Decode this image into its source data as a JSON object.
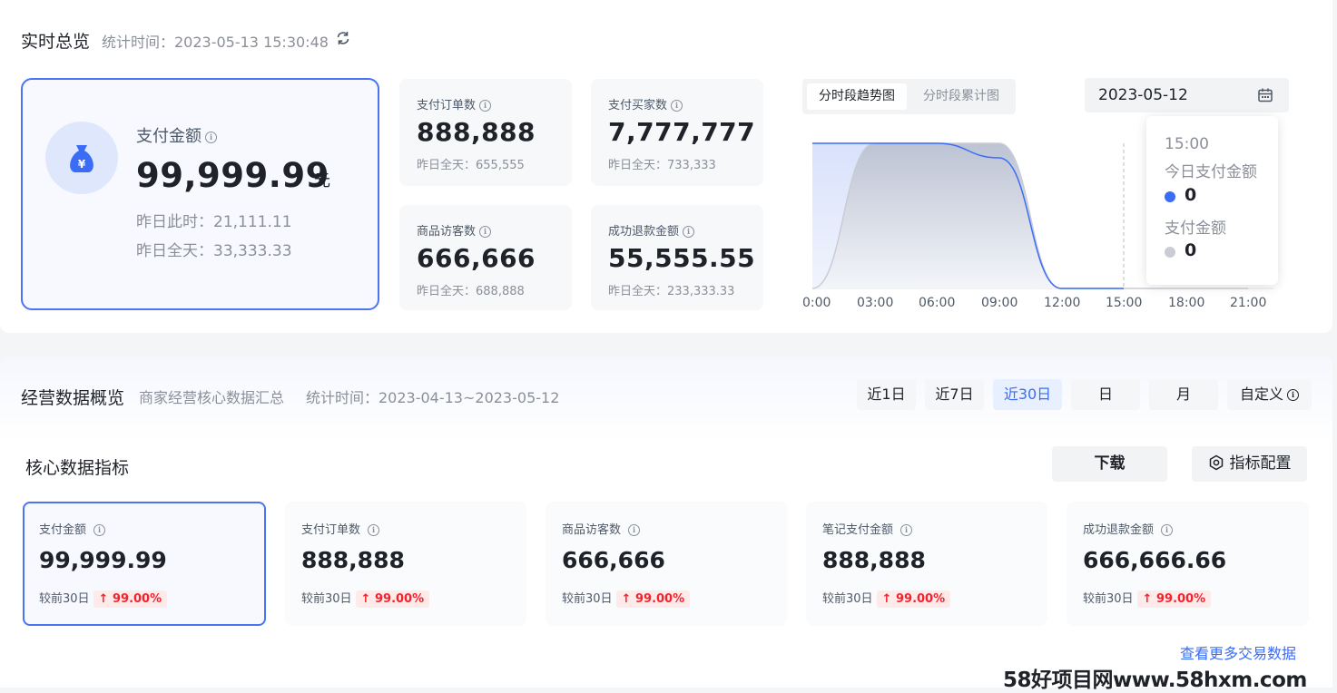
{
  "realtime": {
    "title": "实时总览",
    "time_label": "统计时间：2023-05-13 15:30:48",
    "main": {
      "label": "支付金额",
      "value": "99,999.99",
      "unit": "元",
      "yesterday_now": "昨日此时：21,111.11",
      "yesterday_full": "昨日全天：33,333.33"
    },
    "cards": [
      {
        "label": "支付订单数",
        "value": "888,888",
        "sub": "昨日全天：655,555"
      },
      {
        "label": "支付买家数",
        "value": "7,777,777",
        "sub": "昨日全天：733,333"
      },
      {
        "label": "商品访客数",
        "value": "666,666",
        "sub": "昨日全天：688,888"
      },
      {
        "label": "成功退款金额",
        "value": "55,555.55",
        "sub": "昨日全天：233,333.33"
      }
    ],
    "chart_tabs": [
      "分时段趋势图",
      "分时段累计图"
    ],
    "date": "2023-05-12",
    "tooltip": {
      "time": "15:00",
      "series1_label": "今日支付金额",
      "series1_value": "0",
      "series2_label": "支付金额",
      "series2_value": "0"
    }
  },
  "chart_data": {
    "type": "area",
    "x": [
      "0:00",
      "03:00",
      "06:00",
      "09:00",
      "12:00",
      "15:00",
      "18:00",
      "21:00"
    ],
    "series": [
      {
        "name": "今日支付金额",
        "color": "#3b6cf6",
        "values": [
          1,
          1,
          1,
          0.9,
          0,
          0,
          null,
          null
        ]
      },
      {
        "name": "支付金额",
        "color": "#c9ccd4",
        "values": [
          0,
          1,
          1,
          1,
          0,
          0,
          0,
          0
        ]
      }
    ],
    "hover_x": "15:00"
  },
  "business": {
    "title": "经营数据概览",
    "subtitle": "商家经营核心数据汇总",
    "time_label": "统计时间：2023-04-13~2023-05-12",
    "ranges": [
      "近1日",
      "近7日",
      "近30日",
      "日",
      "月",
      "自定义"
    ],
    "active_range": "近30日",
    "core_title": "核心数据指标",
    "download": "下载",
    "config": "指标配置",
    "metrics": [
      {
        "label": "支付金额",
        "value": "99,999.99",
        "comp": "较前30日",
        "change": "99.00%"
      },
      {
        "label": "支付订单数",
        "value": "888,888",
        "comp": "较前30日",
        "change": "99.00%"
      },
      {
        "label": "商品访客数",
        "value": "666,666",
        "comp": "较前30日",
        "change": "99.00%"
      },
      {
        "label": "笔记支付金额",
        "value": "888,888",
        "comp": "较前30日",
        "change": "99.00%"
      },
      {
        "label": "成功退款金额",
        "value": "666,666.66",
        "comp": "较前30日",
        "change": "99.00%"
      }
    ],
    "more_link": "查看更多交易数据"
  },
  "watermark": "58好项目网www.58hxm.com"
}
